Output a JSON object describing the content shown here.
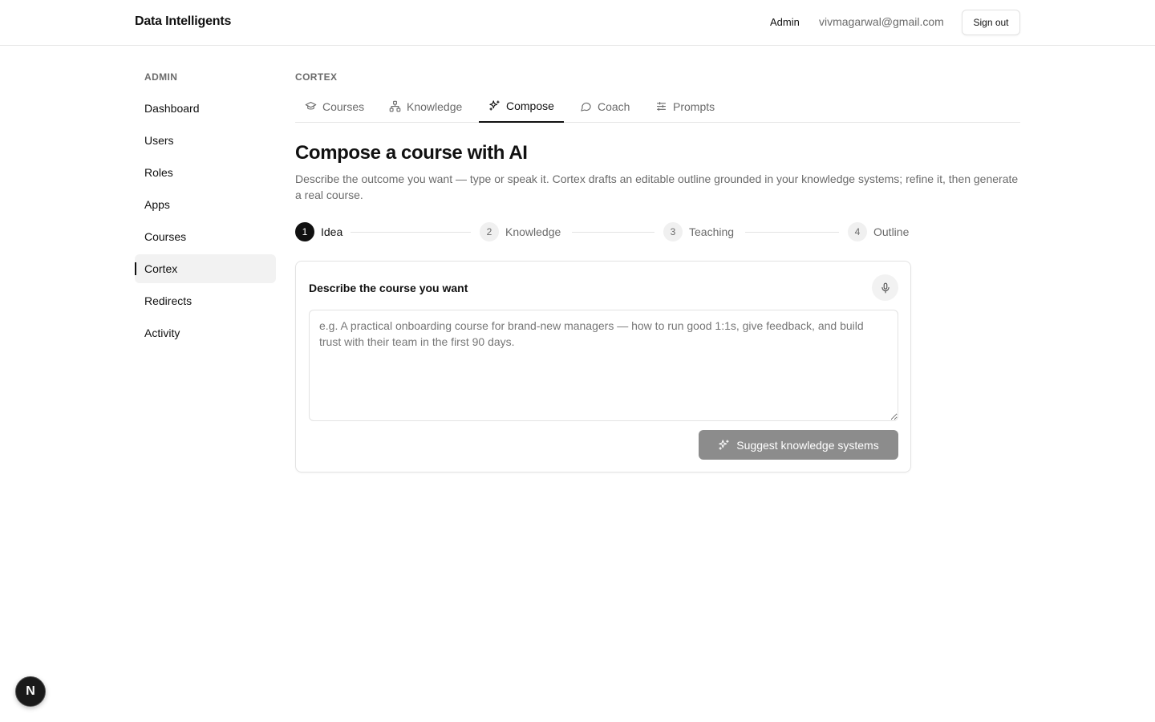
{
  "header": {
    "brand": "Data Intelligents",
    "admin_label": "Admin",
    "email": "vivmagarwal@gmail.com",
    "signout_label": "Sign out"
  },
  "sidebar": {
    "heading": "ADMIN",
    "items": [
      {
        "label": "Dashboard"
      },
      {
        "label": "Users"
      },
      {
        "label": "Roles"
      },
      {
        "label": "Apps"
      },
      {
        "label": "Courses"
      },
      {
        "label": "Cortex",
        "active": true
      },
      {
        "label": "Redirects"
      },
      {
        "label": "Activity"
      }
    ]
  },
  "main": {
    "crumb": "CORTEX",
    "tabs": [
      {
        "label": "Courses",
        "icon": "graduation-cap-icon"
      },
      {
        "label": "Knowledge",
        "icon": "network-icon"
      },
      {
        "label": "Compose",
        "icon": "sparkles-icon",
        "active": true
      },
      {
        "label": "Coach",
        "icon": "chat-bubble-icon"
      },
      {
        "label": "Prompts",
        "icon": "sliders-icon"
      }
    ],
    "title": "Compose a course with AI",
    "description": "Describe the outcome you want — type or speak it. Cortex drafts an editable outline grounded in your knowledge systems; refine it, then generate a real course.",
    "steps": [
      {
        "num": "1",
        "label": "Idea",
        "active": true
      },
      {
        "num": "2",
        "label": "Knowledge"
      },
      {
        "num": "3",
        "label": "Teaching"
      },
      {
        "num": "4",
        "label": "Outline"
      }
    ],
    "card": {
      "title": "Describe the course you want",
      "mic_icon": "microphone-icon",
      "textarea_value": "",
      "textarea_placeholder": "e.g. A practical onboarding course for brand-new managers — how to run good 1:1s, give feedback, and build trust with their team in the first 90 days.",
      "suggest_label": "Suggest knowledge systems"
    }
  },
  "badge": {
    "letter": "N"
  }
}
